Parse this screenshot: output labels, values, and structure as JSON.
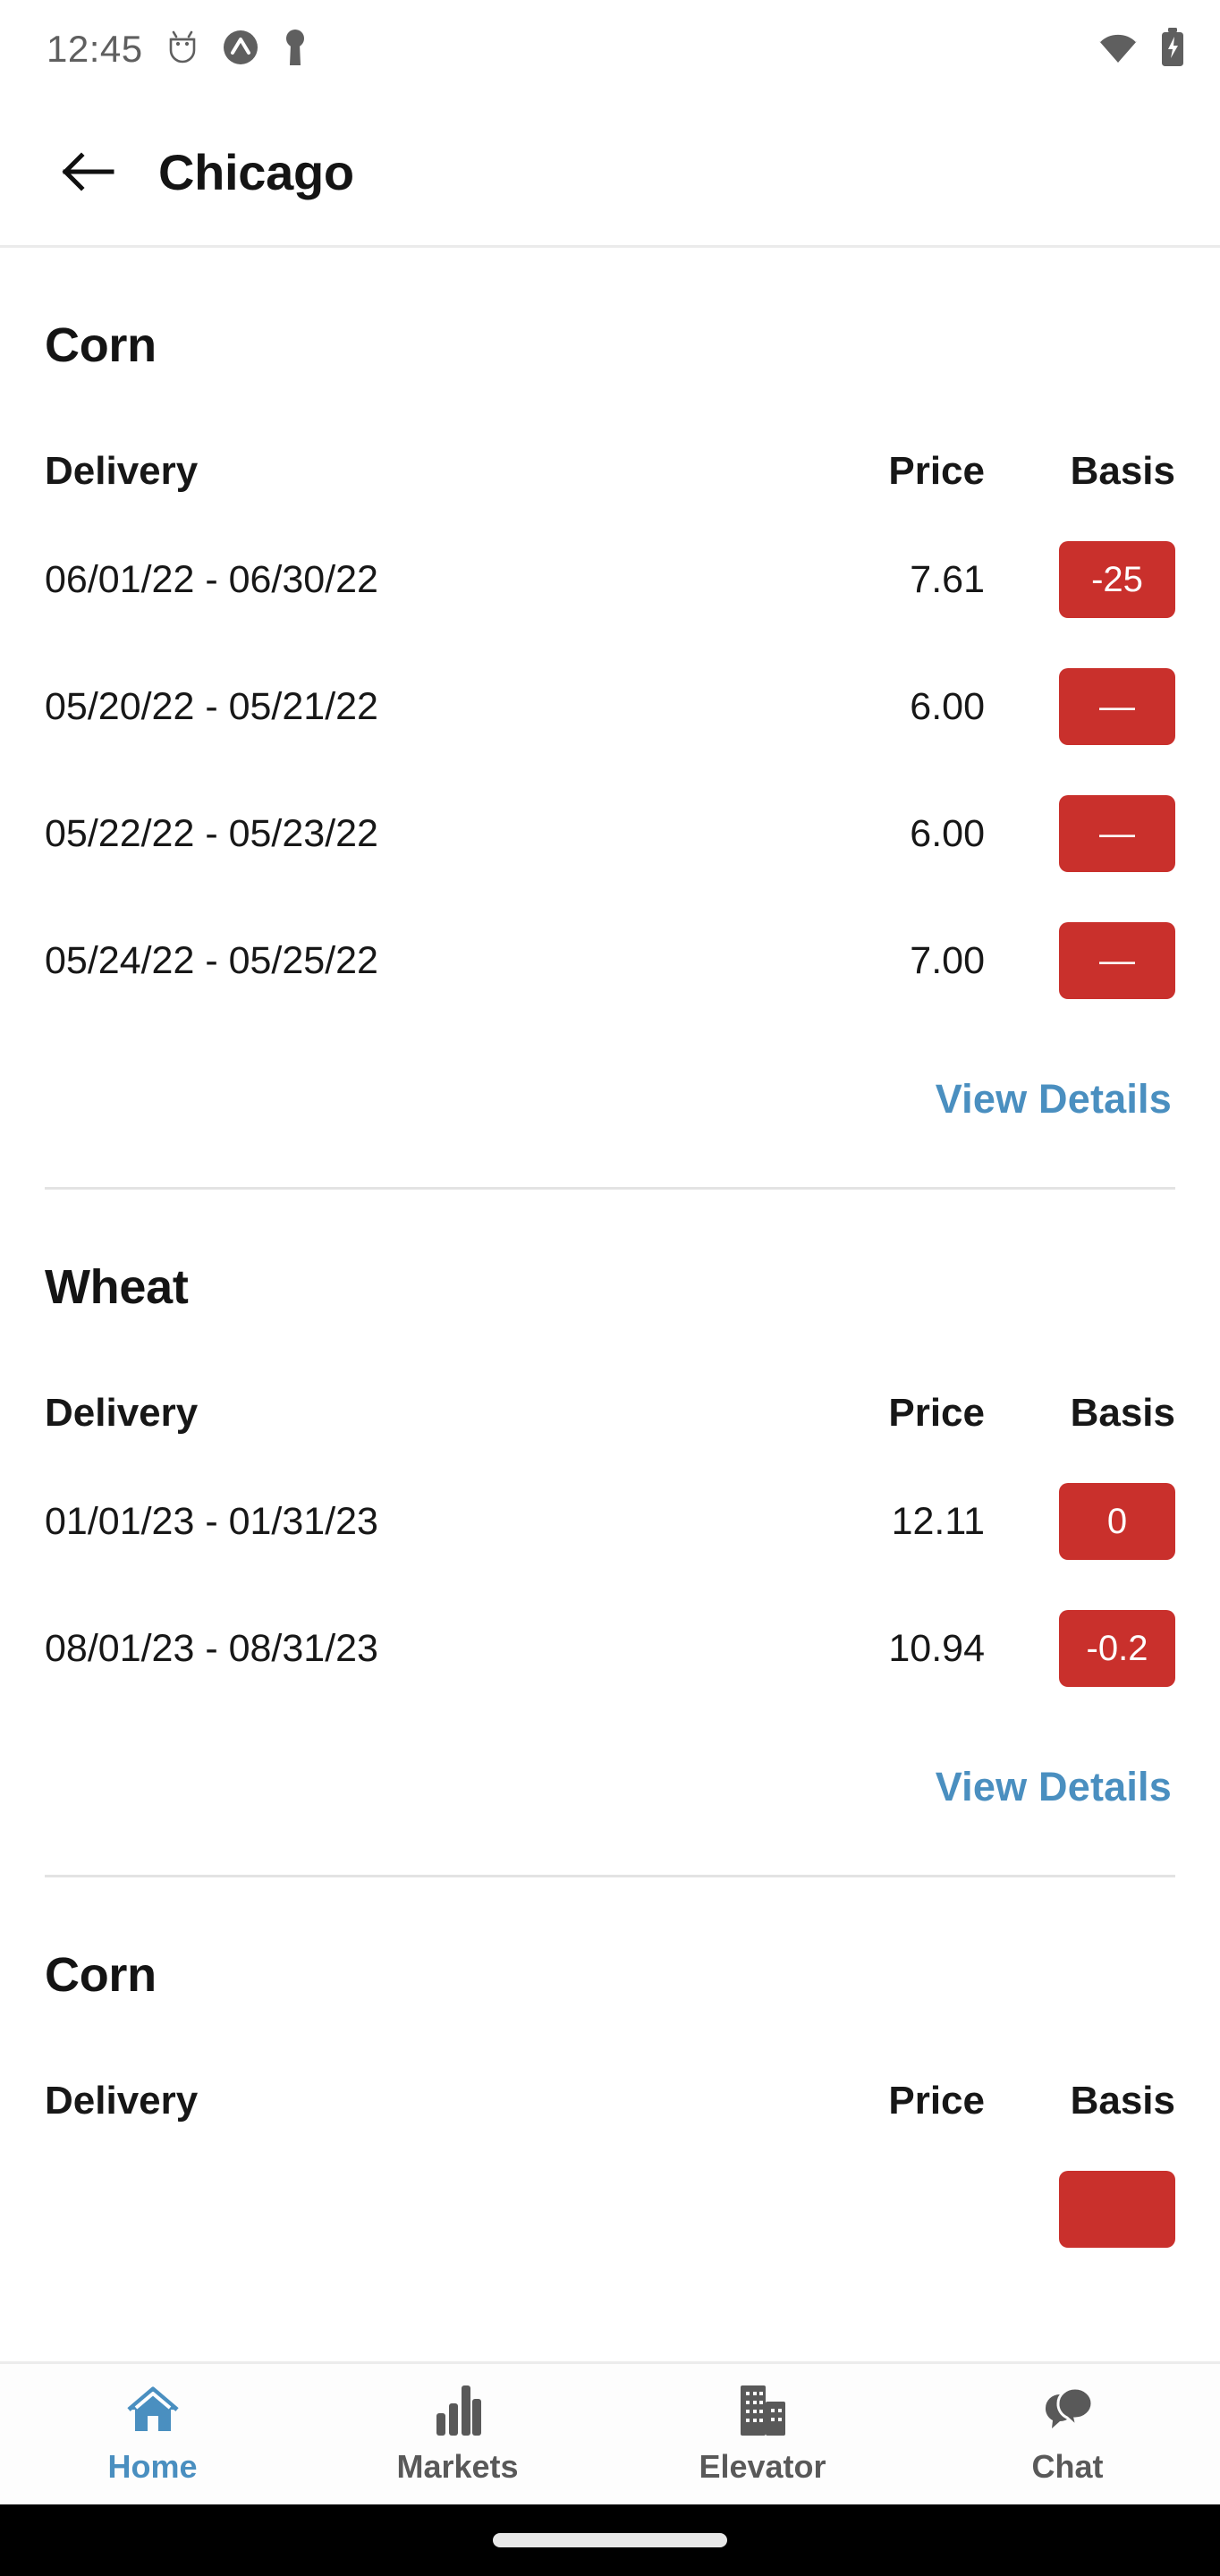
{
  "status_bar": {
    "time": "12:45",
    "left_icons": [
      "android-debug-icon",
      "app-badge-icon",
      "key-icon"
    ],
    "right_icons": [
      "wifi-icon",
      "battery-charging-icon"
    ]
  },
  "app_bar": {
    "back_icon": "arrow-left-icon",
    "title": "Chicago"
  },
  "colors": {
    "accent_blue": "#4a8fc0",
    "badge_red": "#c9302c",
    "text_primary": "#171717",
    "divider": "#e3e3e3"
  },
  "table_headers": {
    "delivery": "Delivery",
    "price": "Price",
    "basis": "Basis"
  },
  "view_details_label": "View Details",
  "sections": [
    {
      "commodity": "Corn",
      "rows": [
        {
          "delivery": "06/01/22 - 06/30/22",
          "price": "7.61",
          "basis": "-25"
        },
        {
          "delivery": "05/20/22 - 05/21/22",
          "price": "6.00",
          "basis": "—"
        },
        {
          "delivery": "05/22/22 - 05/23/22",
          "price": "6.00",
          "basis": "—"
        },
        {
          "delivery": "05/24/22 - 05/25/22",
          "price": "7.00",
          "basis": "—"
        }
      ]
    },
    {
      "commodity": "Wheat",
      "rows": [
        {
          "delivery": "01/01/23 - 01/31/23",
          "price": "12.11",
          "basis": "0"
        },
        {
          "delivery": "08/01/23 - 08/31/23",
          "price": "10.94",
          "basis": "-0.2"
        }
      ]
    },
    {
      "commodity": "Corn",
      "rows": []
    }
  ],
  "bottom_nav": {
    "items": [
      {
        "label": "Home",
        "icon": "home-icon",
        "active": true
      },
      {
        "label": "Markets",
        "icon": "bar-chart-icon",
        "active": false
      },
      {
        "label": "Elevator",
        "icon": "buildings-icon",
        "active": false
      },
      {
        "label": "Chat",
        "icon": "chat-bubbles-icon",
        "active": false
      }
    ]
  }
}
